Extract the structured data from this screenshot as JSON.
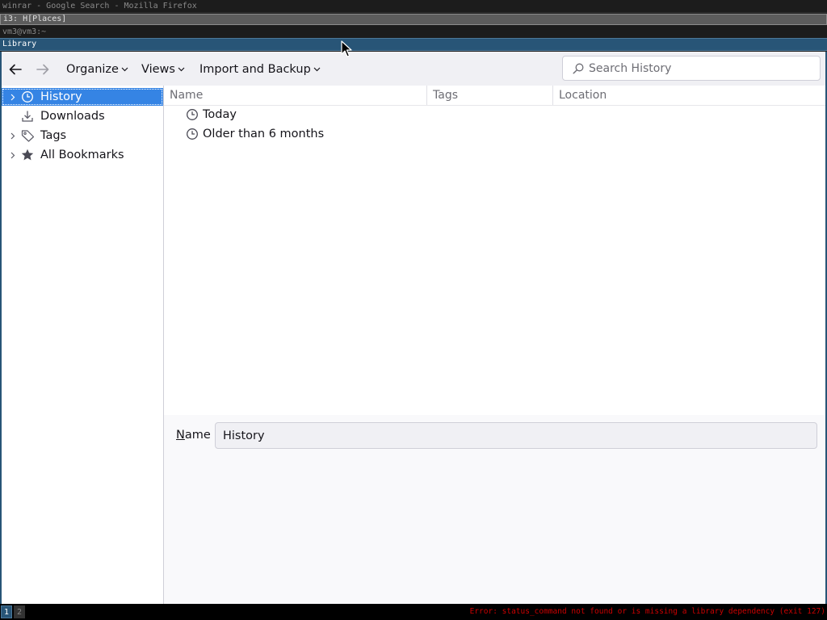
{
  "wm": {
    "title_bar_1": "winrar - Google Search - Mozilla Firefox",
    "title_bar_2": "i3: H[Places]",
    "title_bar_3": "vm3@vm3:~",
    "active_window_title": "Library"
  },
  "toolbar": {
    "back_icon": "arrow-left-icon",
    "forward_icon": "arrow-right-icon",
    "organize_label": "Organize",
    "views_label": "Views",
    "import_backup_label": "Import and Backup",
    "search_placeholder": "Search History",
    "search_value": ""
  },
  "tree": {
    "items": [
      {
        "label": "History",
        "icon": "clock-icon",
        "expandable": true,
        "selected": true
      },
      {
        "label": "Downloads",
        "icon": "download-icon",
        "expandable": false,
        "selected": false
      },
      {
        "label": "Tags",
        "icon": "tag-icon",
        "expandable": true,
        "selected": false
      },
      {
        "label": "All Bookmarks",
        "icon": "star-icon",
        "expandable": true,
        "selected": false
      }
    ]
  },
  "table": {
    "columns": [
      "Name",
      "Tags",
      "Location"
    ],
    "rows": [
      {
        "name": "Today",
        "icon": "clock-icon",
        "tags": "",
        "location": ""
      },
      {
        "name": "Older than 6 months",
        "icon": "clock-icon",
        "tags": "",
        "location": ""
      }
    ]
  },
  "details": {
    "name_label_access_key": "N",
    "name_label_rest": "ame",
    "name_value": "History"
  },
  "statusbar": {
    "workspaces": [
      "1",
      "2"
    ],
    "active_workspace": "1",
    "error_text": "Error: status_command not found or is missing a library dependency (exit 127)"
  },
  "colors": {
    "selection": "#3584e4",
    "i3_focused": "#285577",
    "error_red": "#cc0000"
  }
}
